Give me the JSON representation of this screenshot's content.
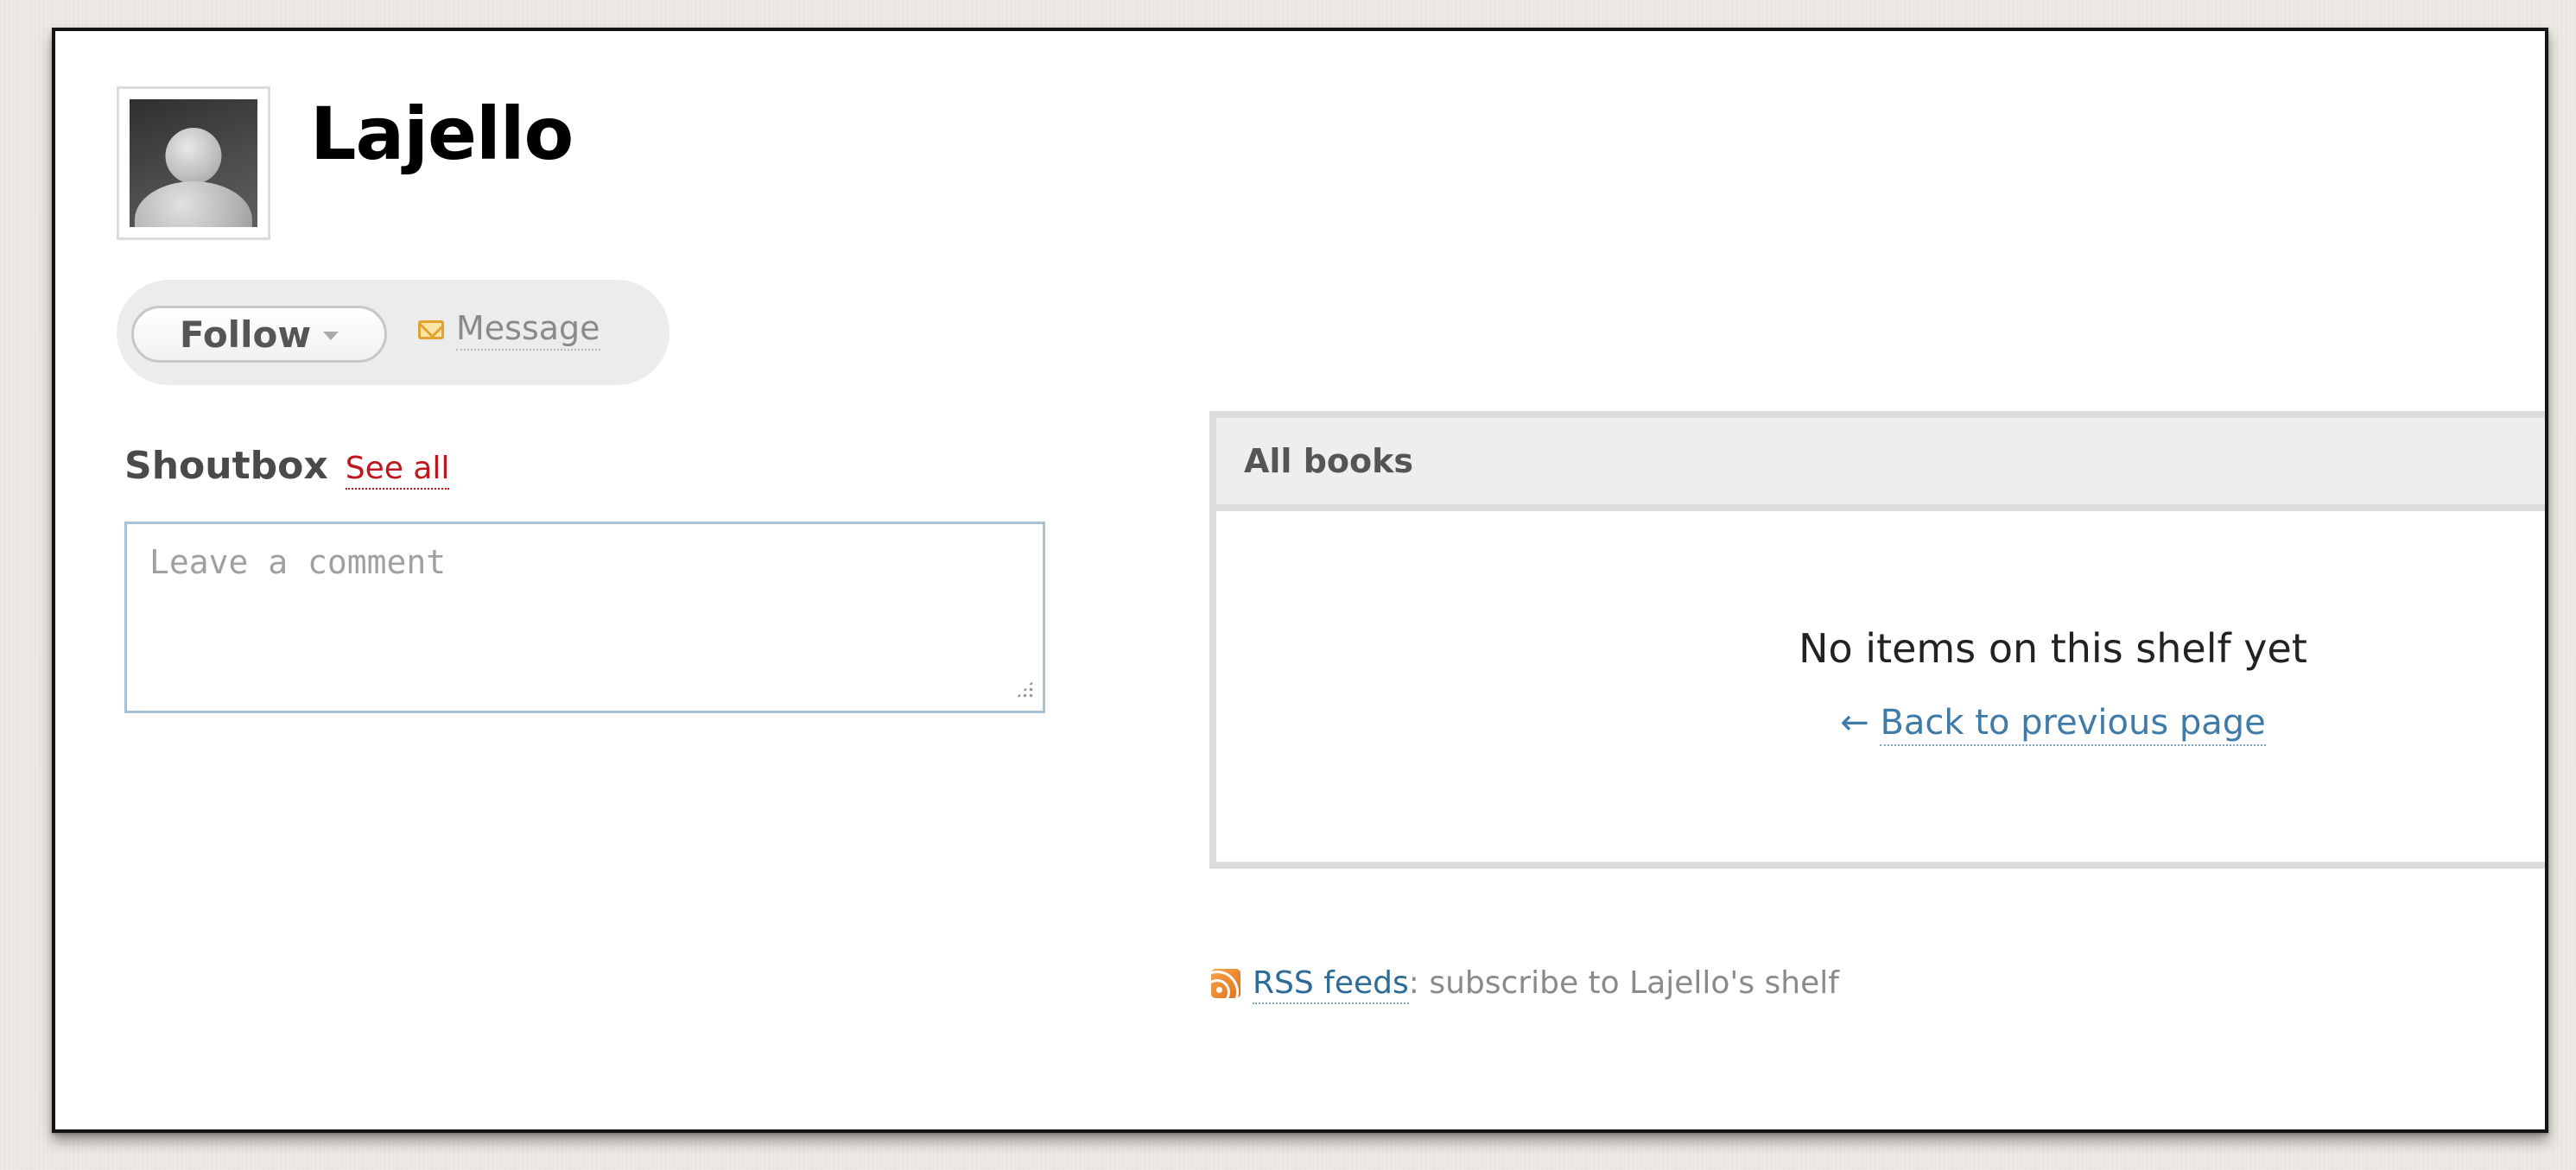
{
  "profile": {
    "username": "Lajello"
  },
  "actions": {
    "follow_label": "Follow",
    "message_label": "Message"
  },
  "shoutbox": {
    "title": "Shoutbox",
    "see_all_label": "See all",
    "comment_placeholder": "Leave a comment",
    "comment_value": ""
  },
  "books_panel": {
    "header": "All books",
    "empty_message": "No items on this shelf yet",
    "back_arrow": "←",
    "back_label": "Back to previous page"
  },
  "rss": {
    "link_label": "RSS feeds",
    "separator": ":",
    "description": " subscribe to Lajello's shelf"
  },
  "icons": {
    "avatar": "default-user-avatar",
    "follow_dropdown": "chevron-down-icon",
    "message": "envelope-icon",
    "rss": "rss-icon",
    "resize": "resize-grip-icon"
  },
  "colors": {
    "link_red": "#c0161d",
    "link_blue": "#2d6b98",
    "rss_orange": "#e0701a",
    "frame_border": "#141414"
  }
}
